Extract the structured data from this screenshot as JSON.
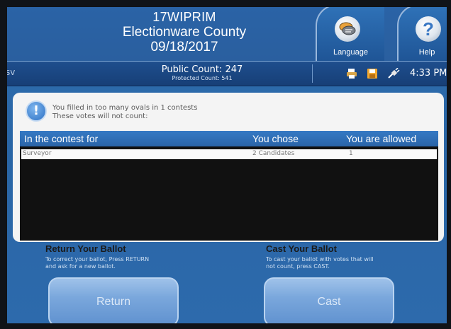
{
  "header": {
    "election": "17WIPRIM",
    "county": "Electionware County",
    "date": "09/18/2017",
    "language_label": "Language",
    "help_label": "Help",
    "help_glyph": "?"
  },
  "status": {
    "left_fragment": "sv",
    "public_count": "Public Count: 247",
    "protected_count": "Protected Count: 541",
    "time": "4:33 PM"
  },
  "warning": {
    "icon_glyph": "!",
    "line1": "You filled in too many ovals in 1 contests",
    "line2": "These votes will not count:"
  },
  "table": {
    "headers": [
      "In the contest for",
      "You chose",
      "You are allowed"
    ],
    "rows": [
      {
        "contest": "Surveyor",
        "chose": "2 Candidates",
        "allowed": "1"
      }
    ]
  },
  "instructions": {
    "return_title": "Return Your Ballot",
    "return_line1": "To correct your ballot, Press RETURN",
    "return_line2": "and ask for a new ballot.",
    "cast_title": "Cast Your Ballot",
    "cast_line1": "To cast your ballot with votes that will",
    "cast_line2": "not count, press CAST."
  },
  "buttons": {
    "return_label": "Return",
    "cast_label": "Cast"
  },
  "colors": {
    "background": "#2d6aac",
    "header_accent": "#3579c4",
    "panel": "#f4f4f4",
    "table_bg": "#111111",
    "button": "#7aa7dc"
  }
}
